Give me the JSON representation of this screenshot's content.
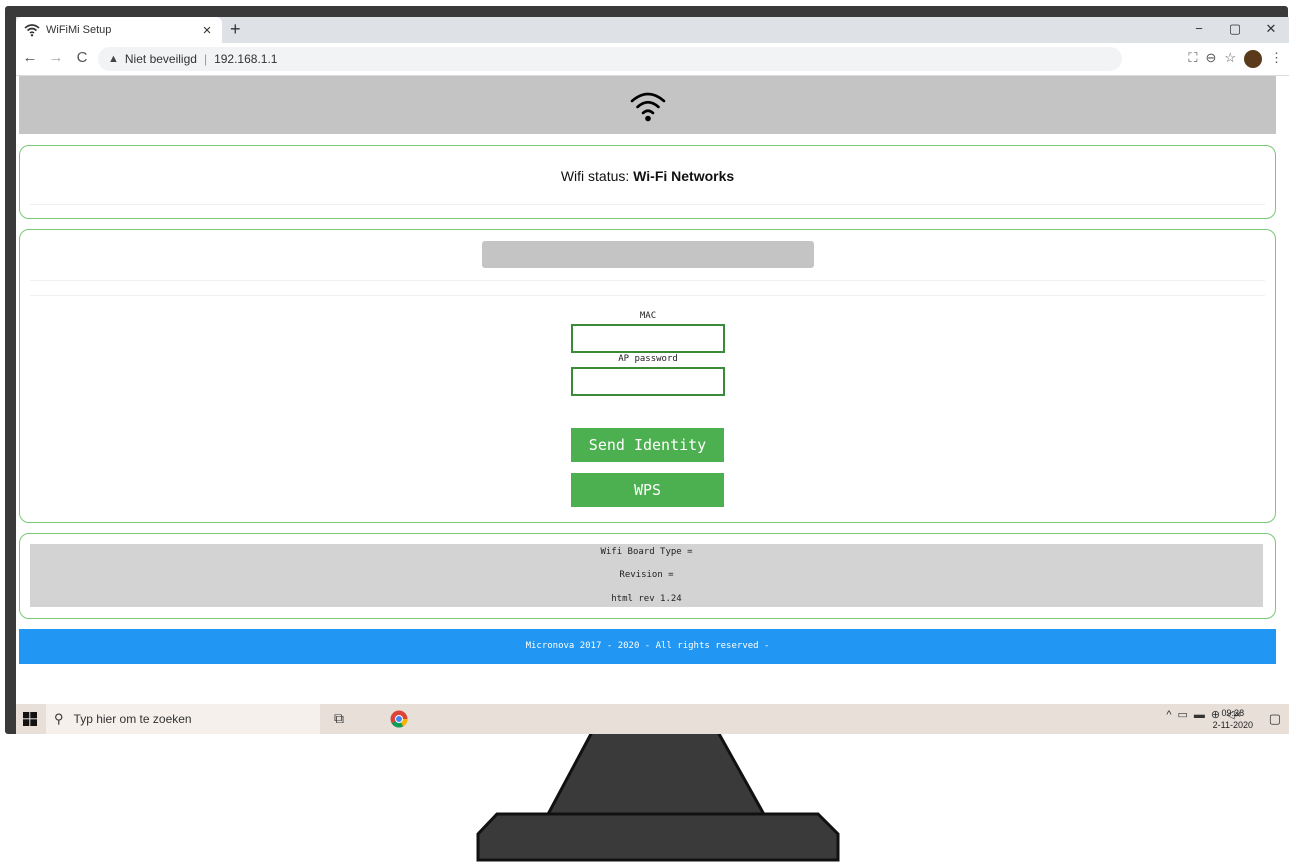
{
  "browser": {
    "tab_title": "WiFiMi Setup",
    "tab_close": "×",
    "new_tab": "+",
    "window_controls": [
      "−",
      "▢",
      "✕"
    ],
    "security_label": "Niet beveiligd",
    "separator": "|",
    "url": "192.168.1.1"
  },
  "page": {
    "status_prefix": "Wifi status: ",
    "status_value": "Wi-Fi Networks",
    "mac_label": "MAC",
    "mac_value": "",
    "ap_password_label": "AP password",
    "ap_password_value": "",
    "send_identity_label": "Send Identity",
    "wps_label": "WPS",
    "board_type_line": "Wifi Board Type =",
    "revision_line": "Revision =",
    "html_rev_line": "html rev 1.24",
    "footer_text": "Micronova 2017 - 2020 - All rights reserved -"
  },
  "taskbar": {
    "search_placeholder": "Typ hier om te zoeken",
    "time": "09:28",
    "date": "2-11-2020"
  },
  "colors": {
    "accent_green": "#4caf50",
    "card_border": "#79c779",
    "footer_blue": "#2196f3",
    "header_grey": "#c4c4c4"
  }
}
